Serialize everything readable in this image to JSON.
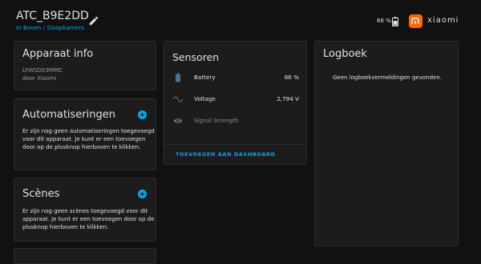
{
  "header": {
    "title": "ATC_B9E2DD",
    "breadcrumb": "In Boven / Slaapkamers",
    "battery_text": "66 %",
    "brand": "xiaomi"
  },
  "device_info": {
    "title": "Apparaat info",
    "model": "LYWSD03MMC",
    "manufacturer": "door Xiaomi"
  },
  "automations": {
    "title": "Automatiseringen",
    "text": "Er zijn nog geen automatiseringen toegevoegd voor dit apparaat. Je kunt er een toevoegen door op de plusknop hierboven te klikken."
  },
  "scenes": {
    "title": "Scènes",
    "text": "Er zijn nog geen scènes toegevoegd voor dit apparaat. Je kunt er een toevoegen door op de plusknop hierboven te klikken."
  },
  "sensors": {
    "title": "Sensoren",
    "rows": [
      {
        "label": "Battery",
        "value": "66 %",
        "icon": "battery-icon"
      },
      {
        "label": "Voltage",
        "value": "2,794 V",
        "icon": "sine-wave-icon"
      },
      {
        "label": "Signal Strength",
        "value": "",
        "icon": "eye-icon"
      }
    ],
    "add_to_dashboard": "TOEVOEGEN AAN DASHBOARD"
  },
  "logbook": {
    "title": "Logboek",
    "empty_text": "Geen logboekvermeldingen gevonden."
  },
  "colors": {
    "accent": "#03a9f4",
    "brand": "#ff6900",
    "background": "#111111",
    "card": "#1c1c1c"
  }
}
